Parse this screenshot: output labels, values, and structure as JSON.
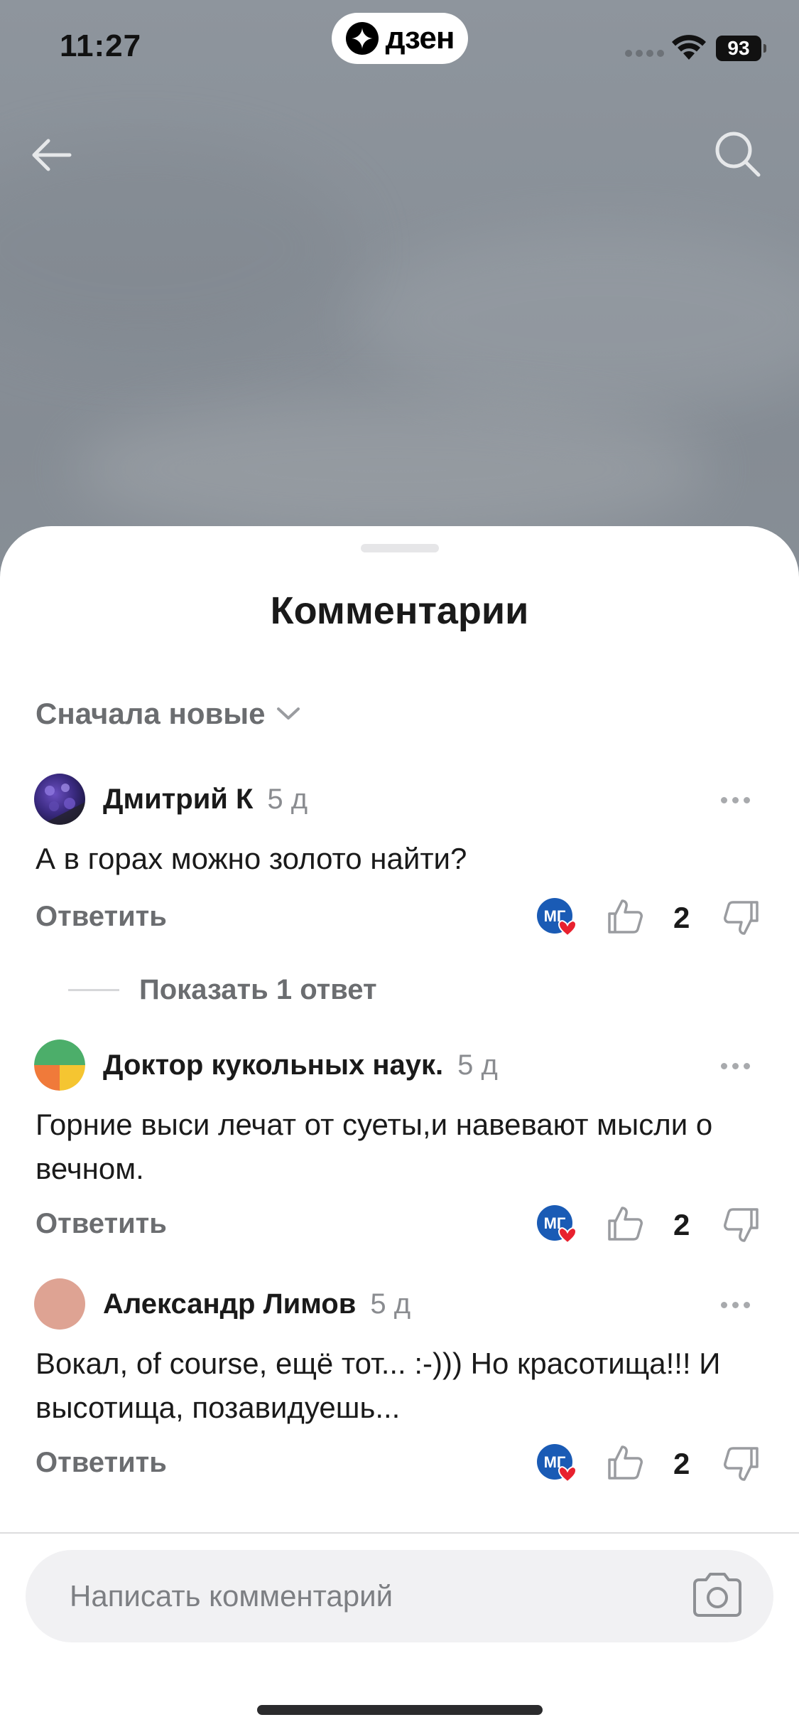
{
  "status_bar": {
    "time": "11:27",
    "app_badge": "дзен",
    "battery": "93"
  },
  "sheet": {
    "title": "Комментарии",
    "sort_label": "Сначала новые"
  },
  "comments": [
    {
      "author": "Дмитрий К",
      "time": "5 д",
      "text": "А в горах можно золото найти?",
      "reply_label": "Ответить",
      "likes": "2",
      "avatar_icon": "purple-flower-photo"
    },
    {
      "author": "Доктор кукольных наук.",
      "time": "5 д",
      "text": "Горние выси лечат от суеты,и навевают мысли о вечном.",
      "reply_label": "Ответить",
      "likes": "2",
      "avatar_icon": "green-orange-circle"
    },
    {
      "author": "Александр Лимов",
      "time": "5 д",
      "text": "Вокал, of course, ещё тот... :-))) Но красотища!!! И высотища, позавидуешь...",
      "reply_label": "Ответить",
      "likes": "2",
      "avatar_icon": "peach-circle"
    }
  ],
  "author_badge": "МГ",
  "show_replies_label": "Показать 1 ответ",
  "composer": {
    "placeholder": "Написать комментарий"
  },
  "colors": {
    "accent_blue": "#1a5bb5",
    "heart_red": "#e8212e",
    "muted_text": "#6b6d70"
  }
}
